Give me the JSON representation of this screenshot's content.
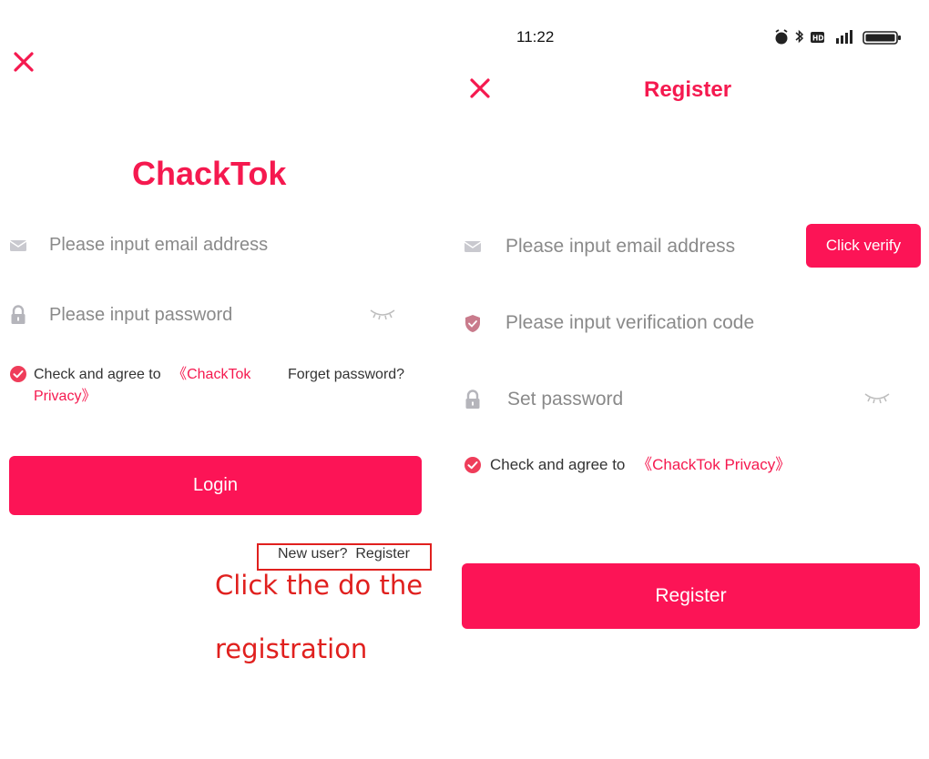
{
  "login": {
    "app_name": "ChackTok",
    "email_placeholder": "Please input email address",
    "password_placeholder": "Please input password",
    "agree_prefix": "Check and agree to ",
    "agree_link_part1": "《ChackTok",
    "agree_link_part2": "Privacy》",
    "forget_password": "Forget password?",
    "login_button": "Login",
    "register_link": "New user?  Register"
  },
  "annotation": {
    "instruction_line1": "Click the do the",
    "instruction_line2": "registration",
    "highlight_color": "#e0201e"
  },
  "register": {
    "status_time": "11:22",
    "title": "Register",
    "email_placeholder": "Please input email address",
    "verify_button": "Click verify",
    "code_placeholder": "Please input verification code",
    "password_placeholder": "Set password",
    "agree_prefix": "Check and agree to ",
    "agree_link": "《ChackTok Privacy》",
    "register_button": "Register"
  },
  "colors": {
    "accent": "#fc1456",
    "text_gray": "#8a8a8a"
  },
  "icons": {
    "close": "close-icon",
    "mail": "mail-icon",
    "lock": "lock-icon",
    "shield": "shield-icon",
    "eye_closed": "eye-closed-icon",
    "check_circle": "check-circle-icon"
  }
}
